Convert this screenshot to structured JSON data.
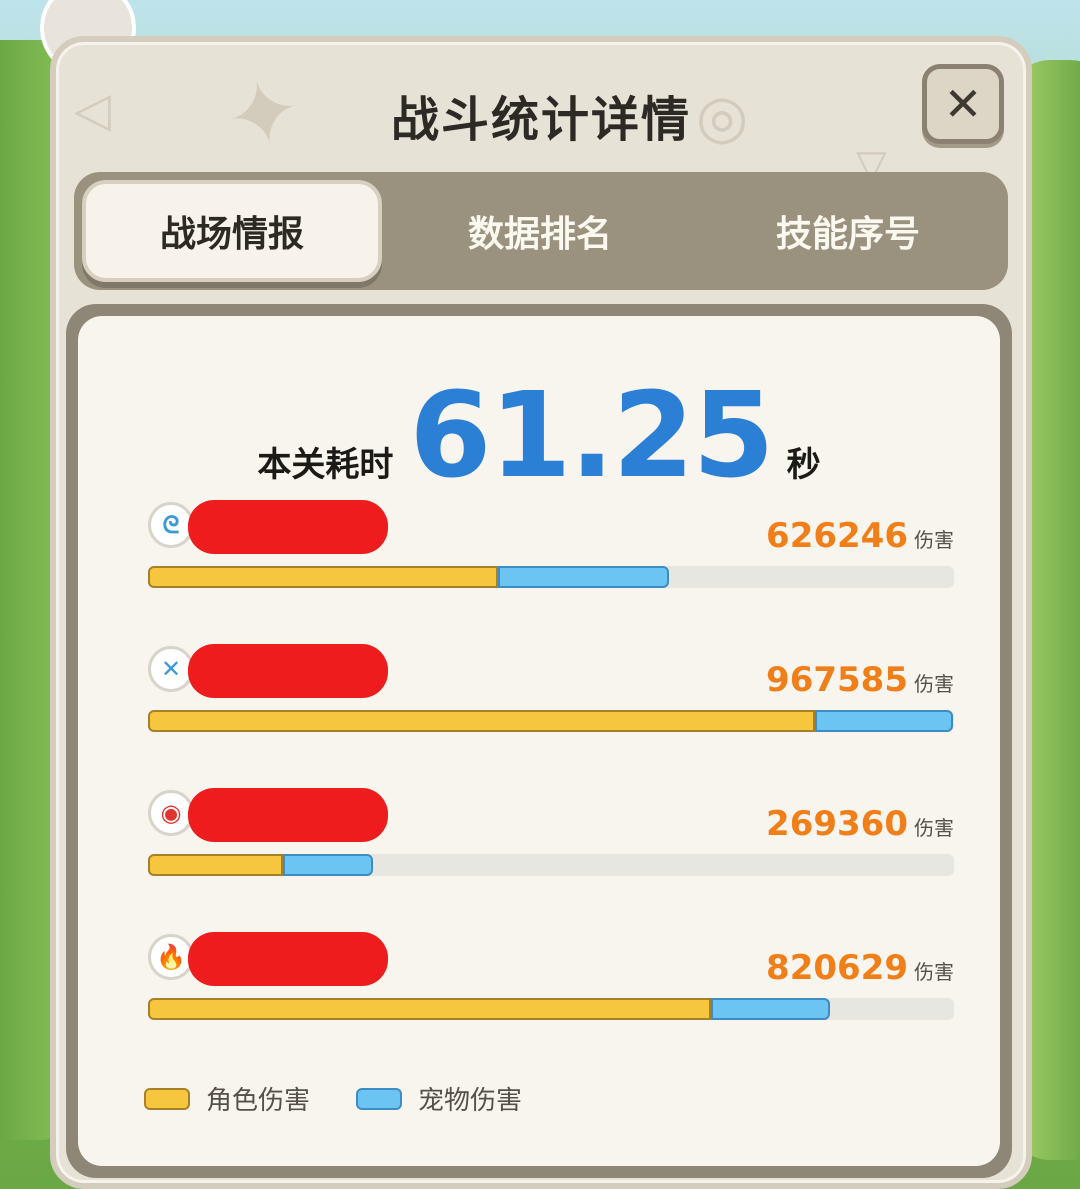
{
  "panel": {
    "title": "战斗统计详情",
    "close_icon": "close-icon",
    "tabs": [
      {
        "label": "战场情报",
        "active": true
      },
      {
        "label": "数据排名",
        "active": false
      },
      {
        "label": "技能序号",
        "active": false
      }
    ]
  },
  "battle": {
    "time_label": "本关耗时",
    "time_value": "61.25",
    "time_unit": "秒",
    "damage_unit": "伤害",
    "rows": [
      {
        "icon": "wind-swirl-icon",
        "icon_color": "#3a9ad8",
        "damage": "626246",
        "role_fraction": 0.434,
        "pet_fraction": 0.212
      },
      {
        "icon": "crossed-blades-icon",
        "icon_color": "#3a9ad8",
        "damage": "967585",
        "role_fraction": 0.827,
        "pet_fraction": 0.171
      },
      {
        "icon": "red-flame-orb-icon",
        "icon_color": "#e0342e",
        "damage": "269360",
        "role_fraction": 0.167,
        "pet_fraction": 0.112
      },
      {
        "icon": "fire-claw-icon",
        "icon_color": "#f07f1a",
        "damage": "820629",
        "role_fraction": 0.698,
        "pet_fraction": 0.148
      }
    ]
  },
  "legend": {
    "role_label": "角色伤害",
    "pet_label": "宠物伤害",
    "role_color": "#f6c73e",
    "pet_color": "#6cc4f2"
  },
  "colors": {
    "time_value": "#2b7fd4",
    "damage_number": "#f07f1a",
    "redaction": "#ee1c1c"
  }
}
